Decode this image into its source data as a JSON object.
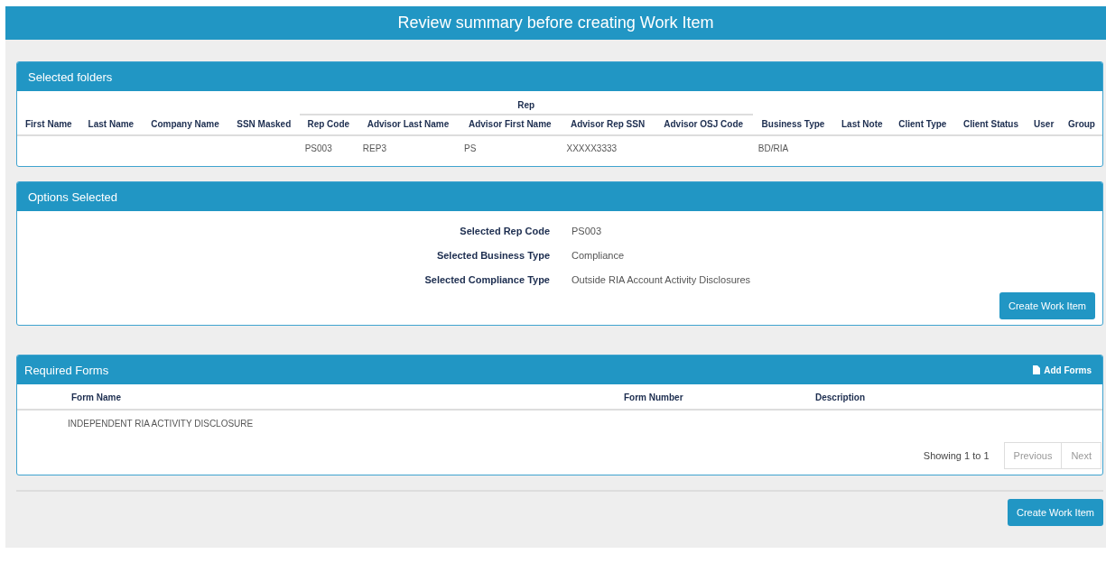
{
  "header": {
    "title": "Review summary before creating Work Item"
  },
  "selected_folders": {
    "title": "Selected folders",
    "columns_before": [
      {
        "label": "First Name"
      },
      {
        "label": "Last Name"
      },
      {
        "label": "Company Name"
      },
      {
        "label": "SSN Masked"
      }
    ],
    "group": {
      "label": "Rep",
      "columns": [
        {
          "label": "Rep Code",
          "cells": [
            "PS003"
          ]
        },
        {
          "label": "Advisor Last Name",
          "cells": [
            "REP3"
          ]
        },
        {
          "label": "Advisor First Name",
          "cells": [
            "PS"
          ]
        },
        {
          "label": "Advisor Rep SSN",
          "cells": [
            "XXXXX3333"
          ]
        },
        {
          "label": "Advisor OSJ Code"
        }
      ]
    },
    "columns_after": [
      {
        "label": "Business Type",
        "cells": [
          "BD/RIA"
        ]
      },
      {
        "label": "Last Note"
      },
      {
        "label": "Client Type"
      },
      {
        "label": "Client Status"
      },
      {
        "label": "User"
      },
      {
        "label": "Group"
      }
    ]
  },
  "options_selected": {
    "title": "Options Selected",
    "items": [
      {
        "label": "Selected Rep Code",
        "value": "PS003"
      },
      {
        "label": "Selected Business Type",
        "value": "Compliance"
      },
      {
        "label": "Selected Compliance Type",
        "value": "Outside RIA Account Activity Disclosures"
      }
    ],
    "button": "Create Work Item"
  },
  "required_forms": {
    "title": "Required Forms",
    "add_button": "Add Forms",
    "columns": [
      {
        "label": "Form Name",
        "cells": [
          "INDEPENDENT RIA ACTIVITY DISCLOSURE"
        ]
      },
      {
        "label": "Form Number"
      },
      {
        "label": "Description"
      }
    ],
    "showing": "Showing 1 to 1",
    "pager": [
      {
        "label": "Previous",
        "disabled": true
      },
      {
        "label": "Next",
        "disabled": true
      }
    ]
  },
  "footer_button": "Create Work Item"
}
